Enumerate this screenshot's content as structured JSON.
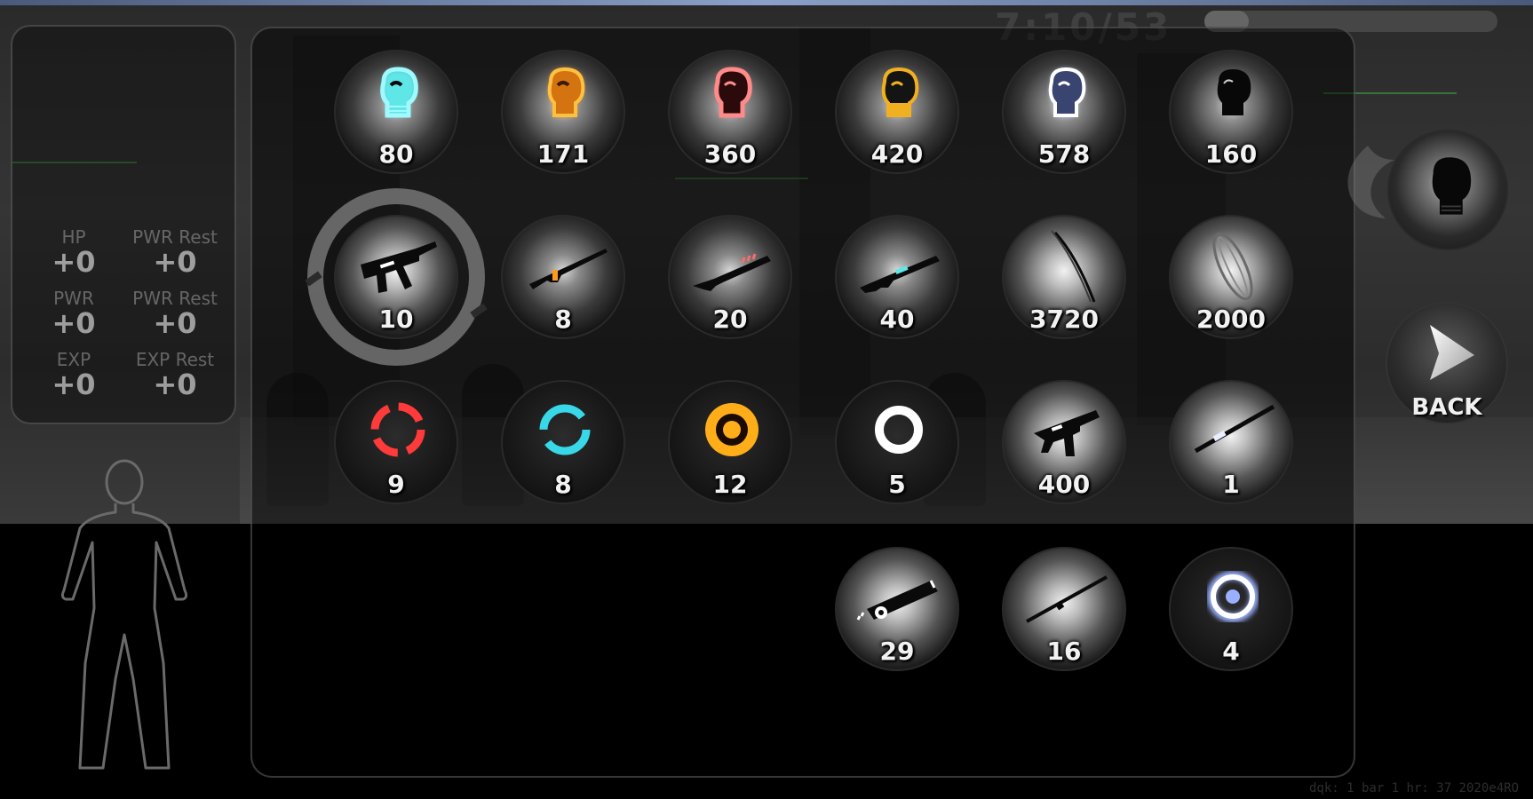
{
  "hud": {
    "timer": "7:10/53",
    "progress": 0.15,
    "footer": "dqk: 1 bar 1 hr: 37 2020e4RO"
  },
  "stats": {
    "hp": {
      "label": "HP",
      "value": "+0"
    },
    "pwr_rest_1": {
      "label": "PWR Rest",
      "value": "+0"
    },
    "pwr": {
      "label": "PWR",
      "value": "+0"
    },
    "pwr_rest_2": {
      "label": "PWR Rest",
      "value": "+0"
    },
    "exp": {
      "label": "EXP",
      "value": "+0"
    },
    "exp_rest": {
      "label": "EXP Rest",
      "value": "+0"
    }
  },
  "inventory": {
    "row1": [
      {
        "icon": "glove-cyan-icon",
        "count": "80"
      },
      {
        "icon": "glove-orange-icon",
        "count": "171"
      },
      {
        "icon": "glove-red-icon",
        "count": "360"
      },
      {
        "icon": "glove-gold-icon",
        "count": "420"
      },
      {
        "icon": "glove-white-icon",
        "count": "578"
      },
      {
        "icon": "glove-black-icon",
        "count": "160"
      }
    ],
    "row2": [
      {
        "icon": "smg-icon",
        "count": "10",
        "selected": true
      },
      {
        "icon": "sniper-rifle-icon",
        "count": "8"
      },
      {
        "icon": "shotgun-icon",
        "count": "20"
      },
      {
        "icon": "assault-rifle-icon",
        "count": "40"
      },
      {
        "icon": "sword-icon",
        "count": "3720"
      },
      {
        "icon": "shield-blade-icon",
        "count": "2000"
      }
    ],
    "row3": [
      {
        "icon": "red-ring-icon",
        "count": "9"
      },
      {
        "icon": "cyan-ring-icon",
        "count": "8"
      },
      {
        "icon": "orange-ring-icon",
        "count": "12"
      },
      {
        "icon": "white-ring-icon",
        "count": "5"
      },
      {
        "icon": "uzi-icon",
        "count": "400"
      },
      {
        "icon": "staff-icon",
        "count": "1"
      }
    ],
    "row4": [
      {
        "icon": "rocket-launcher-icon",
        "count": "29"
      },
      {
        "icon": "katana-icon",
        "count": "16"
      },
      {
        "icon": "blue-ring-icon",
        "count": "4"
      }
    ]
  },
  "sidebar": {
    "equipped_icon": "glove-black-icon",
    "back_label": "BACK",
    "back_icon": "play-arrow-icon"
  },
  "colors": {
    "cyan": "#5fe6e6",
    "orange": "#ff9a1a",
    "red": "#ff6a6a",
    "gold": "#f0b020",
    "white_blue": "#c8d4ff",
    "ring_red": "#ff3a3a",
    "ring_cyan": "#38d8e8",
    "ring_orange": "#ffae1a",
    "ring_blue": "#9ab0ff"
  }
}
